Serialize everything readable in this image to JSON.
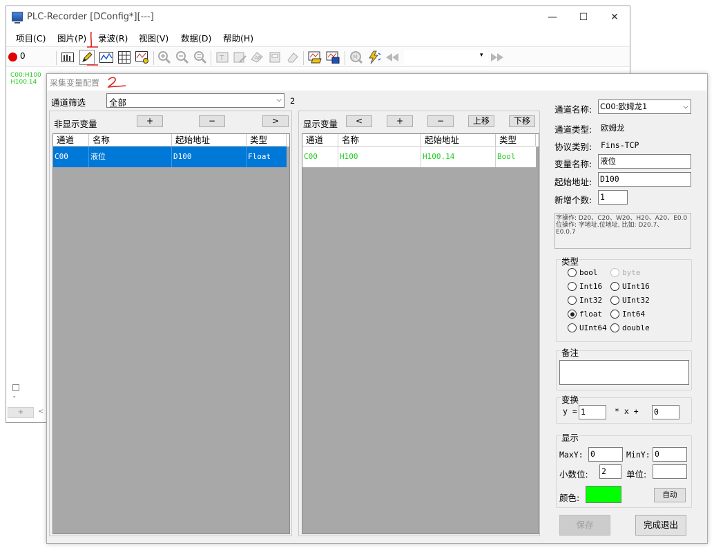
{
  "window": {
    "title": "PLC-Recorder   [DConfig*][---]",
    "minimize": "—",
    "maximize": "☐",
    "close": "✕"
  },
  "menu": [
    "项目(C)",
    "图片(P)",
    "录波(R)",
    "视图(V)",
    "数据(D)",
    "帮助(H)"
  ],
  "toolbar": {
    "record_count": "0",
    "icons": [
      "bar-chart-icon",
      "pencil-icon",
      "wave-icon",
      "grid-icon",
      "signal-icon",
      "zoom-in-icon",
      "zoom-out-icon",
      "zoom-reset-icon",
      "tag-icon",
      "edit-tag-icon",
      "label-icon",
      "print-icon",
      "eraser-icon",
      "open-file-icon",
      "save-file-icon",
      "m-icon",
      "lightning-icon",
      "rewind-icon",
      "fast-forward-icon"
    ],
    "combo_value": ""
  },
  "left_panel": {
    "legend_line1": "C00:H100",
    "legend_line2": "H100.14",
    "dash": "-",
    "add_button": "+",
    "nav_prev": "<"
  },
  "dialog": {
    "title": "采集变量配置",
    "annotation_2": "2",
    "annotation_1": "1",
    "filter_label": "通道筛选",
    "filter_value": "全部",
    "filter_count": "2",
    "hidden_vars": {
      "label": "非显示变量",
      "btn_add": "+",
      "btn_remove": "−",
      "btn_move_right": ">",
      "columns": [
        "通道",
        "名称",
        "起始地址",
        "类型"
      ],
      "rows": [
        {
          "channel": "C00",
          "name": "液位",
          "address": "D100",
          "type": "Float"
        }
      ]
    },
    "shown_vars": {
      "label": "显示变量",
      "btn_move_left": "<",
      "btn_add": "+",
      "btn_remove": "−",
      "btn_up": "上移",
      "btn_down": "下移",
      "columns": [
        "通道",
        "名称",
        "起始地址",
        "类型"
      ],
      "rows": [
        {
          "channel": "C00",
          "name": "H100",
          "address": "H100.14",
          "type": "Bool"
        }
      ]
    },
    "form": {
      "channel_name_label": "通道名称:",
      "channel_name_value": "C00:欧姆龙1",
      "channel_type_label": "通道类型:",
      "channel_type_value": "欧姆龙",
      "protocol_label": "协议类别:",
      "protocol_value": "Fins-TCP",
      "var_name_label": "变量名称:",
      "var_name_value": "液位",
      "start_addr_label": "起始地址:",
      "start_addr_value": "D100",
      "add_count_label": "新增个数:",
      "add_count_value": "1",
      "hint_line1": "字操作: D20、C20、W20、H20、A20、E0.0",
      "hint_line2": "位操作: 字地址.位地址, 比如: D20.7、",
      "hint_line3": "E0.0.7",
      "type_group": "类型",
      "types": [
        {
          "label": "bool",
          "checked": false,
          "disabled": false
        },
        {
          "label": "byte",
          "checked": false,
          "disabled": true
        },
        {
          "label": "Int16",
          "checked": false,
          "disabled": false
        },
        {
          "label": "UInt16",
          "checked": false,
          "disabled": false
        },
        {
          "label": "Int32",
          "checked": false,
          "disabled": false
        },
        {
          "label": "UInt32",
          "checked": false,
          "disabled": false
        },
        {
          "label": "float",
          "checked": true,
          "disabled": false
        },
        {
          "label": "Int64",
          "checked": false,
          "disabled": false
        },
        {
          "label": "UInt64",
          "checked": false,
          "disabled": false
        },
        {
          "label": "double",
          "checked": false,
          "disabled": false
        }
      ],
      "note_group": "备注",
      "note_value": "",
      "transform_group": "变换",
      "transform_y": "y =",
      "transform_k": "1",
      "transform_mid": "* x +",
      "transform_b": "0",
      "display_group": "显示",
      "maxy_label": "MaxY:",
      "maxy_value": "0",
      "miny_label": "MinY:",
      "miny_value": "0",
      "decimal_label": "小数位:",
      "decimal_value": "2",
      "unit_label": "单位:",
      "unit_value": "",
      "color_label": "颜色:",
      "color_value": "#00ff00",
      "auto_button": "自动",
      "save_button": "保存",
      "done_button": "完成退出"
    }
  }
}
